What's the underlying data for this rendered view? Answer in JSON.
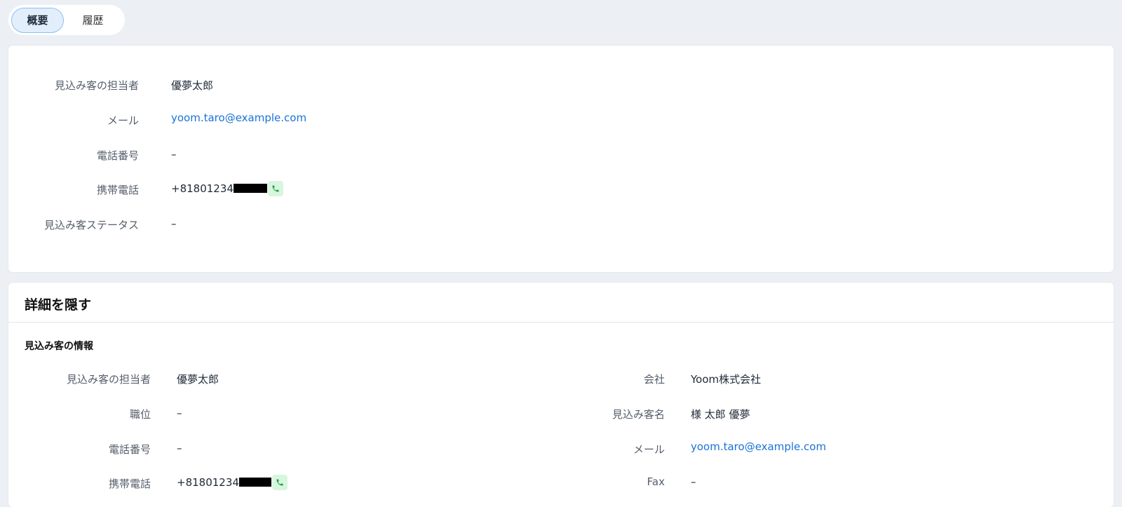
{
  "tabs": [
    {
      "label": "概要",
      "active": true
    },
    {
      "label": "履歴",
      "active": false
    }
  ],
  "summary": {
    "owner_label": "見込み客の担当者",
    "owner_value": "優夢太郎",
    "email_label": "メール",
    "email_value": "yoom.taro@example.com",
    "phone_label": "電話番号",
    "phone_value": "–",
    "mobile_label": "携帯電話",
    "mobile_value": "+81801234",
    "status_label": "見込み客ステータス",
    "status_value": "–"
  },
  "details": {
    "toggle_label": "詳細を隠す",
    "section_title": "見込み客の情報",
    "left": {
      "owner_label": "見込み客の担当者",
      "owner_value": "優夢太郎",
      "title_label": "職位",
      "title_value": "–",
      "phone_label": "電話番号",
      "phone_value": "–",
      "mobile_label": "携帯電話",
      "mobile_value": "+81801234"
    },
    "right": {
      "company_label": "会社",
      "company_value": "Yoom株式会社",
      "name_label": "見込み客名",
      "name_value": "様 太郎 優夢",
      "email_label": "メール",
      "email_value": "yoom.taro@example.com",
      "fax_label": "Fax",
      "fax_value": "–"
    }
  },
  "colors": {
    "link": "#1b72d6",
    "phone_button_bg": "#d8f5df",
    "phone_icon": "#1e9e4a",
    "active_tab_bg": "#e2eefb"
  },
  "icons": {
    "phone": "phone-icon"
  }
}
